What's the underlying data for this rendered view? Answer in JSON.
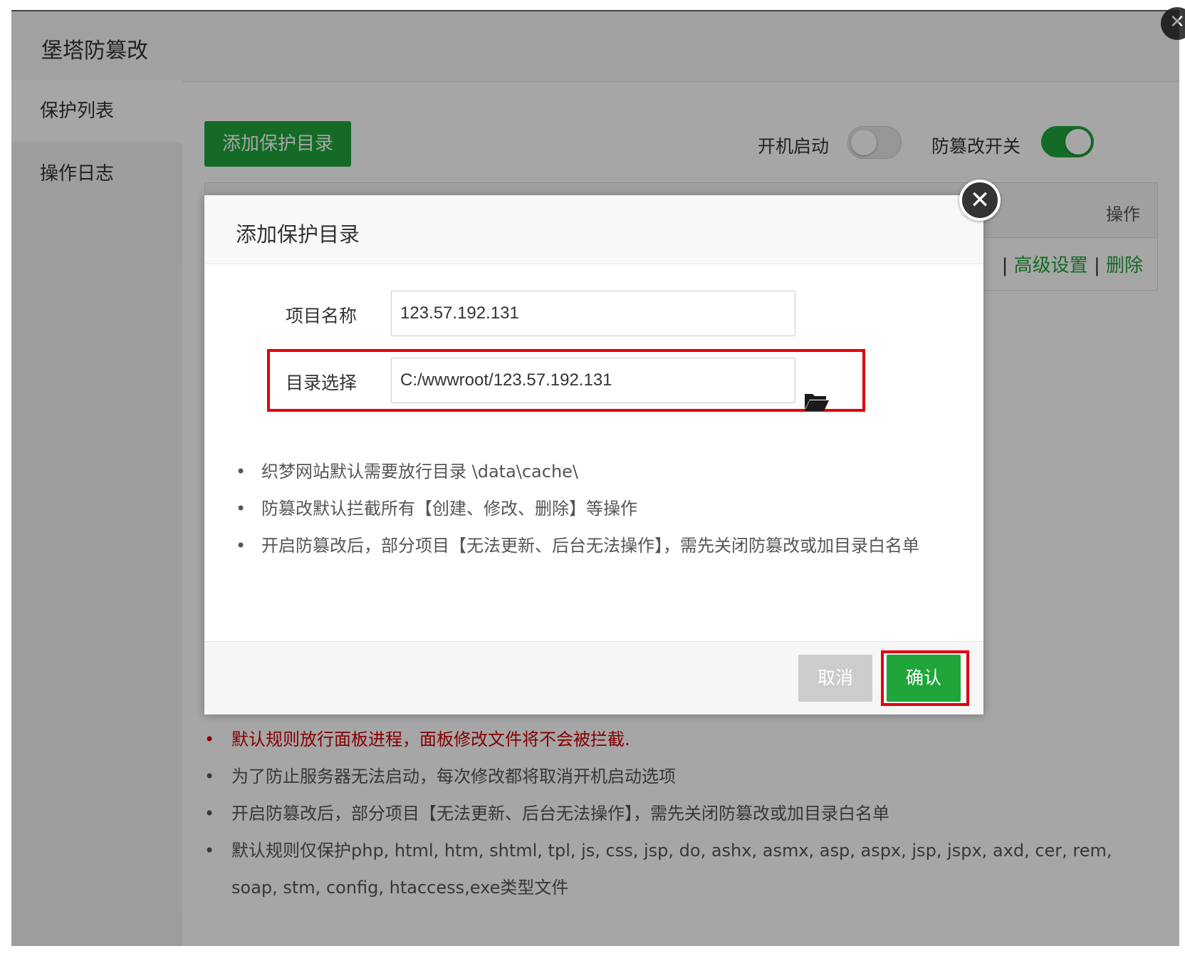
{
  "panel": {
    "title": "堡塔防篡改",
    "close_glyph": "✕"
  },
  "sidebar": {
    "items": [
      {
        "label": "保护列表"
      },
      {
        "label": "操作日志"
      }
    ]
  },
  "toolbar": {
    "add_label": "添加保护目录",
    "boot_label": "开机启动",
    "boot_enabled": false,
    "tamper_label": "防篡改开关",
    "tamper_enabled": true
  },
  "table": {
    "header_op": "操作",
    "row_actions": {
      "sep": "|",
      "advanced": "高级设置",
      "delete": "删除"
    }
  },
  "notes": [
    "默认规则放行面板进程，面板修改文件将不会被拦截.",
    "为了防止服务器无法启动，每次修改都将取消开机启动选项",
    "开启防篡改后，部分项目【无法更新、后台无法操作】，需先关闭防篡改或加目录白名单",
    "默认规则仅保护php, html, htm, shtml, tpl, js, css, jsp, do, ashx, asmx, asp, aspx, jsp, jspx, axd, cer, rem, soap, stm, config, htaccess,exe类型文件"
  ],
  "modal": {
    "title": "添加保护目录",
    "close_glyph": "✕",
    "name_label": "项目名称",
    "name_value": "123.57.192.131",
    "dir_label": "目录选择",
    "dir_value": "C:/wwwroot/123.57.192.131",
    "notes": [
      "织梦网站默认需要放行目录 \\data\\cache\\",
      "防篡改默认拦截所有【创建、修改、删除】等操作",
      "开启防篡改后，部分项目【无法更新、后台无法操作】，需先关闭防篡改或加目录白名单"
    ],
    "cancel_label": "取消",
    "confirm_label": "确认"
  },
  "colors": {
    "accent": "#20a53a",
    "highlight": "#e00010",
    "warning_text": "#cc0000"
  },
  "icons": {
    "folder": "folder-open-icon",
    "close": "close-icon"
  }
}
